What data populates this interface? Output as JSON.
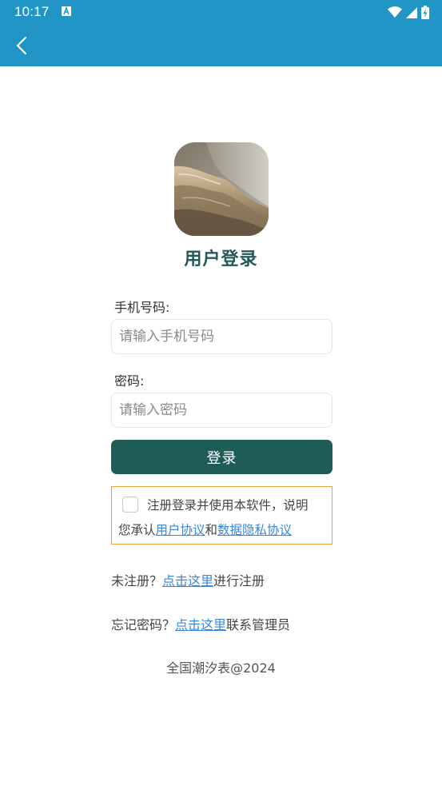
{
  "status_bar": {
    "time": "10:17",
    "color": "#2196c6"
  },
  "app_bar": {
    "back_icon": "chevron-left-icon"
  },
  "page": {
    "title": "用户登录"
  },
  "form": {
    "phone_label": "手机号码:",
    "phone_placeholder": "请输入手机号码",
    "phone_value": "",
    "password_label": "密码:",
    "password_placeholder": "请输入密码",
    "password_value": "",
    "login_button": "登录"
  },
  "agreement": {
    "checked": false,
    "line1": "注册登录并使用本软件，说明",
    "prefix": "您承认",
    "user_agreement_link": "用户协议",
    "conjunction": "和",
    "privacy_link": "数据隐私协议"
  },
  "register": {
    "prefix": "未注册？",
    "link": "点击这里",
    "suffix": "进行注册"
  },
  "forgot": {
    "prefix": "忘记密码？",
    "link": "点击这里",
    "suffix": "联系管理员"
  },
  "footer": {
    "copyright": "全国潮汐表@2024"
  },
  "colors": {
    "primary": "#1f5c58",
    "app_bar": "#2196c6",
    "link": "#3a86d8",
    "agreement_border": "#f0a13a"
  }
}
